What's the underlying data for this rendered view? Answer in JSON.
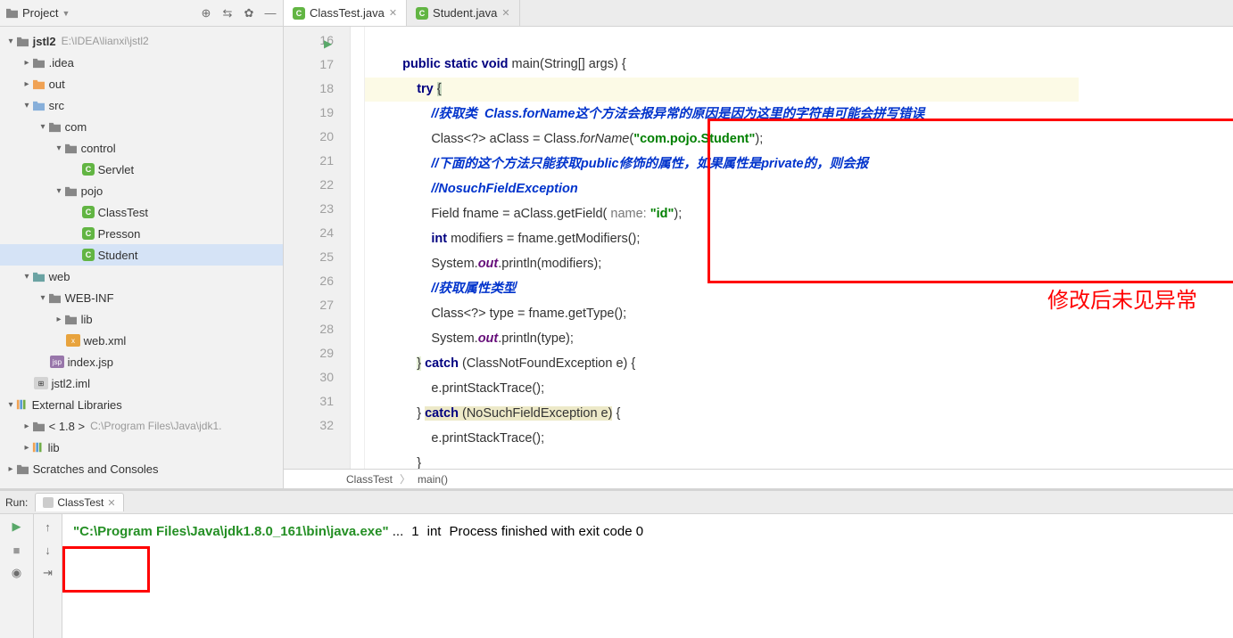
{
  "sidebar": {
    "title": "Project",
    "project": {
      "name": "jstl2",
      "path": "E:\\IDEA\\lianxi\\jstl2"
    },
    "tree": {
      "idea": ".idea",
      "out": "out",
      "src": "src",
      "com": "com",
      "control": "control",
      "servlet": "Servlet",
      "pojo": "pojo",
      "classTest": "ClassTest",
      "presson": "Presson",
      "student": "Student",
      "web": "web",
      "webinf": "WEB-INF",
      "lib": "lib",
      "webxml": "web.xml",
      "indexjsp": "index.jsp",
      "iml": "jstl2.iml",
      "extlib": "External Libraries",
      "jdk": "< 1.8 >",
      "jdkpath": "C:\\Program Files\\Java\\jdk1.",
      "lib2": "lib",
      "scratches": "Scratches and Consoles"
    }
  },
  "tabs": {
    "t1": "ClassTest.java",
    "t2": "Student.java"
  },
  "code": {
    "lines": [
      "16",
      "17",
      "18",
      "19",
      "20",
      "21",
      "22",
      "23",
      "24",
      "25",
      "26",
      "27",
      "28",
      "29",
      "30",
      "31",
      "32"
    ],
    "l16": "public static void main(String[] args) {",
    "l17": "try {",
    "l18": "//获取类  Class.forName这个方法会报异常的原因是因为这里的字符串可能会拼写错误",
    "l19a": "Class<?> aClass = Class.",
    "l19b": "forName",
    "l19c": "(",
    "l19str": "\"com.pojo.Student\"",
    "l19d": ");",
    "l20": "//下面的这个方法只能获取public修饰的属性，如果属性是private的，则会报",
    "l21": "//NosuchFieldException",
    "l22a": "Field fname = aClass.getField(",
    "l22hint": " name: ",
    "l22str": "\"id\"",
    "l22b": ");",
    "l23a": "int",
    "l23b": " modifiers = fname.getModifiers();",
    "l24a": "System.",
    "l24b": "out",
    "l24c": ".println(modifiers);",
    "l25": "//获取属性类型",
    "l26": "Class<?> type = fname.getType();",
    "l27a": "System.",
    "l27b": "out",
    "l27c": ".println(type);",
    "l28a": "} ",
    "l28b": "catch",
    "l28c": " (ClassNotFoundException e) {",
    "l29": "e.printStackTrace();",
    "l30a": "} ",
    "l30b": "catch (NoSuchFieldException e)",
    "l30c": " {",
    "l31": "e.printStackTrace();",
    "l32": "}",
    "annotation": "修改后未见异常"
  },
  "breadcrumb": {
    "a": "ClassTest",
    "b": "main()"
  },
  "run": {
    "label": "Run:",
    "tab": "ClassTest",
    "line1a": "\"C:\\Program Files\\Java\\jdk1.8.0_161\\bin\\java.exe\"",
    "line1b": " ...",
    "line2": "1",
    "line3": "int",
    "line5": "Process finished with exit code 0"
  }
}
